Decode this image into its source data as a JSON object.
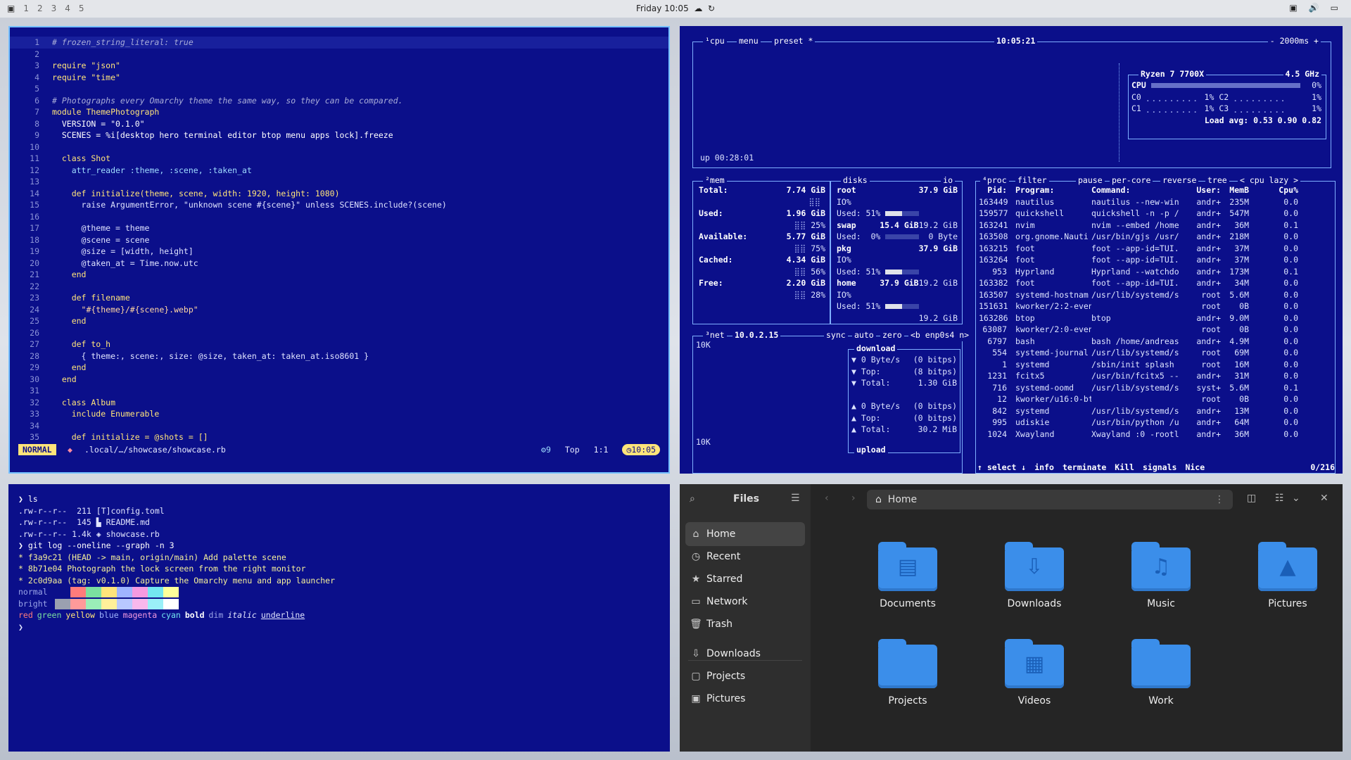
{
  "topbar": {
    "workspaces": [
      "1",
      "2",
      "3",
      "4",
      "5"
    ],
    "clock": "Friday 10:05"
  },
  "editor": {
    "lines": [
      {
        "n": "1",
        "t": "# frozen_string_literal: true",
        "k": "com"
      },
      {
        "n": "2",
        "t": "",
        "k": ""
      },
      {
        "n": "3",
        "t": "require \"json\"",
        "k": "req"
      },
      {
        "n": "4",
        "t": "require \"time\"",
        "k": "req"
      },
      {
        "n": "5",
        "t": "",
        "k": ""
      },
      {
        "n": "6",
        "t": "# Photographs every Omarchy theme the same way, so they can be compared.",
        "k": "com"
      },
      {
        "n": "7",
        "t": "module ThemePhotograph",
        "k": "mod"
      },
      {
        "n": "8",
        "t": "  VERSION = \"0.1.0\"",
        "k": "const"
      },
      {
        "n": "9",
        "t": "  SCENES = %i[desktop hero terminal editor btop menu apps lock].freeze",
        "k": "const"
      },
      {
        "n": "10",
        "t": "",
        "k": ""
      },
      {
        "n": "11",
        "t": "  class Shot",
        "k": "mod"
      },
      {
        "n": "12",
        "t": "    attr_reader :theme, :scene, :taken_at",
        "k": "attr"
      },
      {
        "n": "13",
        "t": "",
        "k": ""
      },
      {
        "n": "14",
        "t": "    def initialize(theme, scene, width: 1920, height: 1080)",
        "k": "def"
      },
      {
        "n": "15",
        "t": "      raise ArgumentError, \"unknown scene #{scene}\" unless SCENES.include?(scene)",
        "k": "plain"
      },
      {
        "n": "16",
        "t": "",
        "k": ""
      },
      {
        "n": "17",
        "t": "      @theme = theme",
        "k": "plain"
      },
      {
        "n": "18",
        "t": "      @scene = scene",
        "k": "plain"
      },
      {
        "n": "19",
        "t": "      @size = [width, height]",
        "k": "plain"
      },
      {
        "n": "20",
        "t": "      @taken_at = Time.now.utc",
        "k": "plain"
      },
      {
        "n": "21",
        "t": "    end",
        "k": "kw"
      },
      {
        "n": "22",
        "t": "",
        "k": ""
      },
      {
        "n": "23",
        "t": "    def filename",
        "k": "def"
      },
      {
        "n": "24",
        "t": "      \"#{theme}/#{scene}.webp\"",
        "k": "str"
      },
      {
        "n": "25",
        "t": "    end",
        "k": "kw"
      },
      {
        "n": "26",
        "t": "",
        "k": ""
      },
      {
        "n": "27",
        "t": "    def to_h",
        "k": "def"
      },
      {
        "n": "28",
        "t": "      { theme:, scene:, size: @size, taken_at: taken_at.iso8601 }",
        "k": "plain"
      },
      {
        "n": "29",
        "t": "    end",
        "k": "kw"
      },
      {
        "n": "30",
        "t": "  end",
        "k": "kw"
      },
      {
        "n": "31",
        "t": "",
        "k": ""
      },
      {
        "n": "32",
        "t": "  class Album",
        "k": "mod"
      },
      {
        "n": "33",
        "t": "    include Enumerable",
        "k": "kw"
      },
      {
        "n": "34",
        "t": "",
        "k": ""
      },
      {
        "n": "35",
        "t": "    def initialize = @shots = []",
        "k": "def"
      }
    ],
    "status": {
      "mode": "NORMAL",
      "path": ".local/…/showcase/showcase.rb",
      "diag": "9",
      "pos_label": "Top",
      "cursor": "1:1",
      "time": "10:05"
    }
  },
  "btop": {
    "cpu_box": {
      "tabs": [
        "¹cpu",
        "menu",
        "preset *"
      ],
      "clock": "10:05:21",
      "interval": "- 2000ms +",
      "uptime": "up 00:28:01",
      "model": "Ryzen 7 7700X",
      "freq": "4.5 GHz",
      "cpu_label": "CPU",
      "cpu_pct": "0%",
      "cores": [
        {
          "name": "C0",
          "pct": "1%"
        },
        {
          "name": "C2",
          "pct": "1%"
        },
        {
          "name": "C1",
          "pct": "1%"
        },
        {
          "name": "C3",
          "pct": "1%"
        }
      ],
      "load": "Load avg: 0.53 0.90 0.82"
    },
    "mem_box": {
      "title": "²mem",
      "rows": [
        {
          "label": "Total:",
          "value": "7.74 GiB",
          "pct": ""
        },
        {
          "label": "Used:",
          "value": "1.96 GiB",
          "pct": "25%"
        },
        {
          "label": "Available:",
          "value": "5.77 GiB",
          "pct": "75%"
        },
        {
          "label": "Cached:",
          "value": "4.34 GiB",
          "pct": "56%"
        },
        {
          "label": "Free:",
          "value": "2.20 GiB",
          "pct": "28%"
        }
      ]
    },
    "disks_box": {
      "title": "disks",
      "io_label": "io",
      "items": [
        {
          "name": "root",
          "size": "37.9 GiB",
          "io": "IO%",
          "used": "Used: 51%",
          "usedval": "19.2 GiB",
          "fill": 0.51
        },
        {
          "name": "swap",
          "size": "15.4 GiB",
          "io": "",
          "used": "Used:  0%",
          "usedval": "0 Byte",
          "fill": 0.0
        },
        {
          "name": "pkg",
          "size": "37.9 GiB",
          "io": "IO%",
          "used": "Used: 51%",
          "usedval": "19.2 GiB",
          "fill": 0.51
        },
        {
          "name": "home",
          "size": "37.9 GiB",
          "io": "IO%",
          "used": "Used: 51%",
          "usedval": "19.2 GiB",
          "fill": 0.51
        }
      ]
    },
    "net_box": {
      "title": "³net",
      "ip": "10.0.2.15",
      "tabs": [
        "sync",
        "auto",
        "zero",
        "<b enp0s4 n>"
      ],
      "scale_top": "10K",
      "scale_bot": "10K",
      "download_label": "download",
      "upload_label": "upload",
      "down": [
        {
          "a": "▼ 0 Byte/s",
          "b": "(0 bitps)"
        },
        {
          "a": "▼ Top:",
          "b": "(8 bitps)"
        },
        {
          "a": "▼ Total:",
          "b": "1.30 GiB"
        }
      ],
      "up": [
        {
          "a": "▲ 0 Byte/s",
          "b": "(0 bitps)"
        },
        {
          "a": "▲ Top:",
          "b": "(0 bitps)"
        },
        {
          "a": "▲ Total:",
          "b": "30.2 MiB"
        }
      ]
    },
    "proc_box": {
      "tabs": [
        "⁴proc",
        "filter",
        "pause",
        "per-core",
        "reverse",
        "tree",
        "< cpu lazy >"
      ],
      "headers": {
        "pid": "Pid:",
        "prog": "Program:",
        "cmd": "Command:",
        "user": "User:",
        "mem": "MemB",
        "cpu": "Cpu%"
      },
      "rows": [
        {
          "pid": "163449",
          "prog": "nautilus",
          "cmd": "nautilus --new-win",
          "user": "andr+",
          "mem": "235M",
          "cpu": "0.0"
        },
        {
          "pid": "159577",
          "prog": "quickshell",
          "cmd": "quickshell -n -p /",
          "user": "andr+",
          "mem": "547M",
          "cpu": "0.0"
        },
        {
          "pid": "163241",
          "prog": "nvim",
          "cmd": "nvim --embed /home",
          "user": "andr+",
          "mem": "36M",
          "cpu": "0.1"
        },
        {
          "pid": "163508",
          "prog": "org.gnome.Nauti",
          "cmd": "/usr/bin/gjs /usr/",
          "user": "andr+",
          "mem": "218M",
          "cpu": "0.0"
        },
        {
          "pid": "163215",
          "prog": "foot",
          "cmd": "foot --app-id=TUI.",
          "user": "andr+",
          "mem": "37M",
          "cpu": "0.0"
        },
        {
          "pid": "163264",
          "prog": "foot",
          "cmd": "foot --app-id=TUI.",
          "user": "andr+",
          "mem": "37M",
          "cpu": "0.0"
        },
        {
          "pid": "953",
          "prog": "Hyprland",
          "cmd": "Hyprland --watchdo",
          "user": "andr+",
          "mem": "173M",
          "cpu": "0.1"
        },
        {
          "pid": "163382",
          "prog": "foot",
          "cmd": "foot --app-id=TUI.",
          "user": "andr+",
          "mem": "34M",
          "cpu": "0.0"
        },
        {
          "pid": "163507",
          "prog": "systemd-hostnam",
          "cmd": "/usr/lib/systemd/s",
          "user": "root",
          "mem": "5.6M",
          "cpu": "0.0"
        },
        {
          "pid": "151631",
          "prog": "kworker/2:2-even",
          "cmd": "",
          "user": "root",
          "mem": "0B",
          "cpu": "0.0"
        },
        {
          "pid": "163286",
          "prog": "btop",
          "cmd": "btop",
          "user": "andr+",
          "mem": "9.0M",
          "cpu": "0.0"
        },
        {
          "pid": "63087",
          "prog": "kworker/2:0-even",
          "cmd": "",
          "user": "root",
          "mem": "0B",
          "cpu": "0.0"
        },
        {
          "pid": "6797",
          "prog": "bash",
          "cmd": "bash /home/andreas",
          "user": "andr+",
          "mem": "4.9M",
          "cpu": "0.0"
        },
        {
          "pid": "554",
          "prog": "systemd-journal",
          "cmd": "/usr/lib/systemd/s",
          "user": "root",
          "mem": "69M",
          "cpu": "0.0"
        },
        {
          "pid": "1",
          "prog": "systemd",
          "cmd": "/sbin/init splash",
          "user": "root",
          "mem": "16M",
          "cpu": "0.0"
        },
        {
          "pid": "1231",
          "prog": "fcitx5",
          "cmd": "/usr/bin/fcitx5 --",
          "user": "andr+",
          "mem": "31M",
          "cpu": "0.0"
        },
        {
          "pid": "716",
          "prog": "systemd-oomd",
          "cmd": "/usr/lib/systemd/s",
          "user": "syst+",
          "mem": "5.6M",
          "cpu": "0.1"
        },
        {
          "pid": "12",
          "prog": "kworker/u16:0-bt",
          "cmd": "",
          "user": "root",
          "mem": "0B",
          "cpu": "0.0"
        },
        {
          "pid": "842",
          "prog": "systemd",
          "cmd": "/usr/lib/systemd/s",
          "user": "andr+",
          "mem": "13M",
          "cpu": "0.0"
        },
        {
          "pid": "995",
          "prog": "udiskie",
          "cmd": "/usr/bin/python /u",
          "user": "andr+",
          "mem": "64M",
          "cpu": "0.0"
        },
        {
          "pid": "1024",
          "prog": "Xwayland",
          "cmd": "Xwayland :0 -rootl",
          "user": "andr+",
          "mem": "36M",
          "cpu": "0.0"
        }
      ],
      "footer": [
        "↑ select ↓",
        "info",
        "terminate",
        "Kill",
        "signals",
        "Nice"
      ],
      "count": "0/216"
    }
  },
  "terminal": {
    "lines": [
      {
        "t": "❯ ls",
        "k": "prompt"
      },
      {
        "t": ".rw-r--r--  211 [T]config.toml",
        "k": "ls"
      },
      {
        "t": ".rw-r--r--  145 ▙ README.md",
        "k": "ls"
      },
      {
        "t": ".rw-r--r-- 1.4k ◈ showcase.rb",
        "k": "ls"
      },
      {
        "t": "❯ git log --oneline --graph -n 3",
        "k": "prompt"
      },
      {
        "t": "* f3a9c21 (HEAD -> main, origin/main) Add palette scene",
        "k": "git"
      },
      {
        "t": "* 8b71e04 Photograph the lock screen from the right monitor",
        "k": "git"
      },
      {
        "t": "* 2c0d9aa (tag: v0.1.0) Capture the Omarchy menu and app launcher",
        "k": "git"
      }
    ],
    "palette_normal_label": "normal",
    "palette_bright_label": "bright",
    "palette_normal": [
      "#0b0f8a",
      "#ff7b7b",
      "#7be0a0",
      "#ffe47a",
      "#9fb4ff",
      "#f59ae0",
      "#73e6f0",
      "#ffff9a"
    ],
    "palette_bright": [
      "#9aa0b0",
      "#ff9a9a",
      "#9aeeb8",
      "#fff09a",
      "#b8c8ff",
      "#f8b8ec",
      "#9af0f8",
      "#ffffff"
    ],
    "styles": [
      "red",
      "green",
      "yellow",
      "blue",
      "magenta",
      "cyan",
      "bold",
      "dim",
      "italic",
      "underline"
    ],
    "final_prompt": "❯"
  },
  "files": {
    "sidebar_title": "Files",
    "sidebar": [
      {
        "label": "Home",
        "icon": "⌂",
        "name": "home"
      },
      {
        "label": "Recent",
        "icon": "◷",
        "name": "recent"
      },
      {
        "label": "Starred",
        "icon": "★",
        "name": "starred"
      },
      {
        "label": "Network",
        "icon": "▭",
        "name": "network"
      },
      {
        "label": "Trash",
        "icon": "🗑",
        "name": "trash"
      },
      {
        "label": "Downloads",
        "icon": "⇩",
        "name": "downloads"
      },
      {
        "label": "Projects",
        "icon": "▢",
        "name": "projects"
      },
      {
        "label": "Pictures",
        "icon": "▣",
        "name": "pictures"
      }
    ],
    "location": "Home",
    "folders": [
      {
        "label": "Documents",
        "glyph": "▤",
        "icon": "document-folder-icon"
      },
      {
        "label": "Downloads",
        "glyph": "⇩",
        "icon": "download-folder-icon"
      },
      {
        "label": "Music",
        "glyph": "♫",
        "icon": "music-folder-icon"
      },
      {
        "label": "Pictures",
        "glyph": "▲",
        "icon": "pictures-folder-icon"
      },
      {
        "label": "Projects",
        "glyph": "",
        "icon": "projects-folder-icon"
      },
      {
        "label": "Videos",
        "glyph": "▦",
        "icon": "videos-folder-icon"
      },
      {
        "label": "Work",
        "glyph": "",
        "icon": "work-folder-icon"
      }
    ]
  }
}
